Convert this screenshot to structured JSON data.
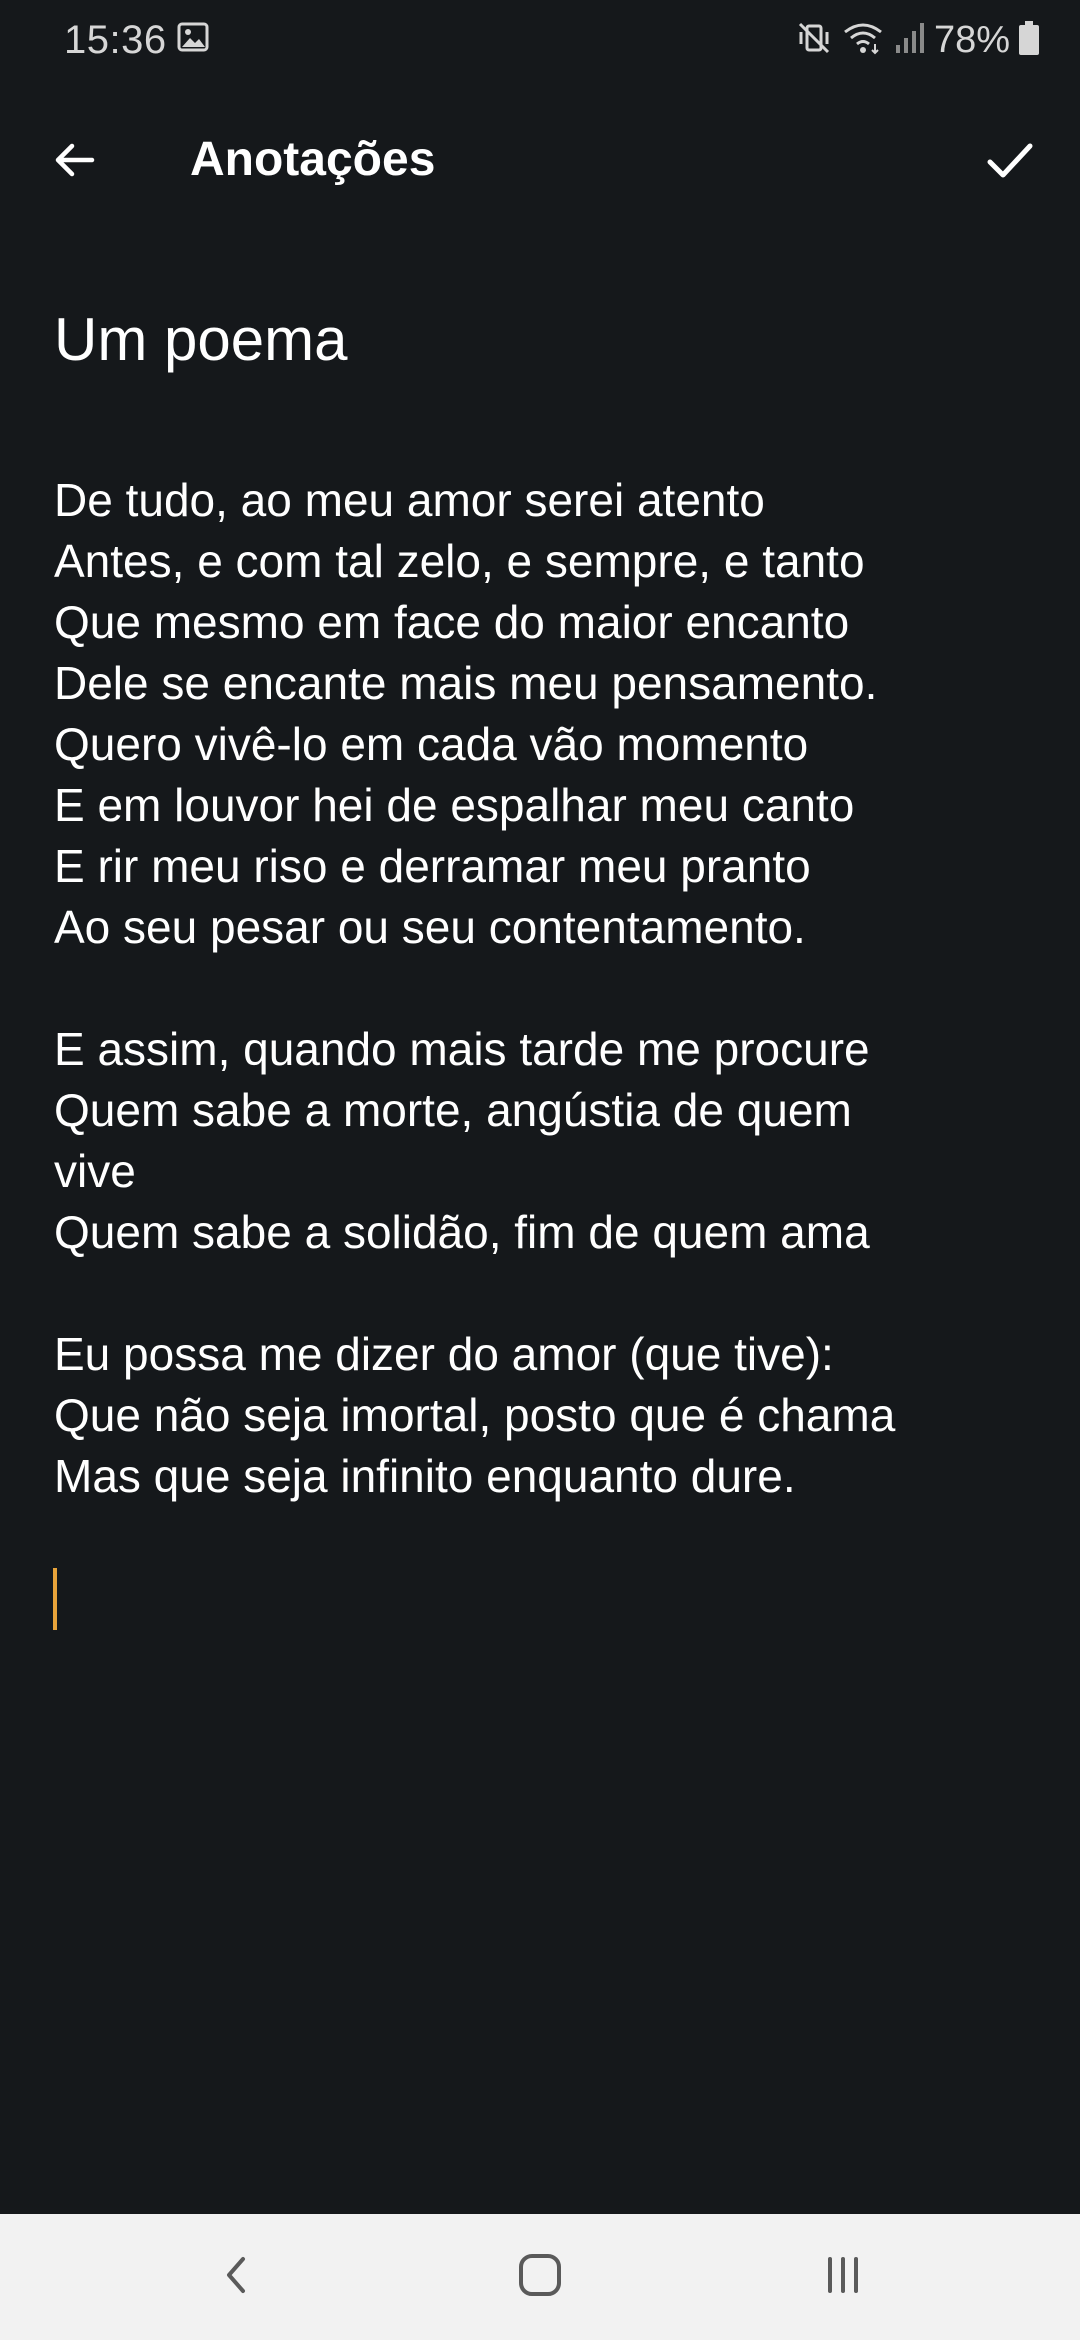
{
  "status_bar": {
    "time": "15:36",
    "battery": "78%",
    "icons": [
      "image-icon",
      "mute-vibrate-icon",
      "wifi-icon",
      "signal-icon",
      "battery-icon"
    ]
  },
  "app_bar": {
    "title": "Anotações",
    "back_icon": "arrow-left-icon",
    "confirm_icon": "check-icon"
  },
  "note": {
    "title": "Um poema",
    "lines": [
      "De tudo, ao meu amor serei atento",
      "Antes, e com tal zelo, e sempre, e tanto",
      "Que mesmo em face do maior encanto",
      "Dele se encante mais meu pensamento.",
      "Quero vivê-lo em cada vão momento",
      "E em louvor hei de espalhar meu canto",
      "E rir meu riso e derramar meu pranto",
      "Ao seu pesar ou seu contentamento.",
      "",
      "E assim, quando mais tarde me procure",
      "Quem sabe a morte, angústia de quem",
      "vive",
      "Quem sabe a solidão, fim de quem ama",
      "",
      "Eu possa me dizer do amor (que tive):",
      "Que não seja imortal, posto que é chama",
      "Mas que seja infinito enquanto dure."
    ]
  },
  "nav_bar": {
    "icons": [
      "nav-back-icon",
      "nav-home-icon",
      "nav-recents-icon"
    ]
  },
  "colors": {
    "background": "#15181b",
    "text": "#ffffff",
    "cursor": "#e8a33a",
    "nav_bar": "#f2f2f2"
  }
}
